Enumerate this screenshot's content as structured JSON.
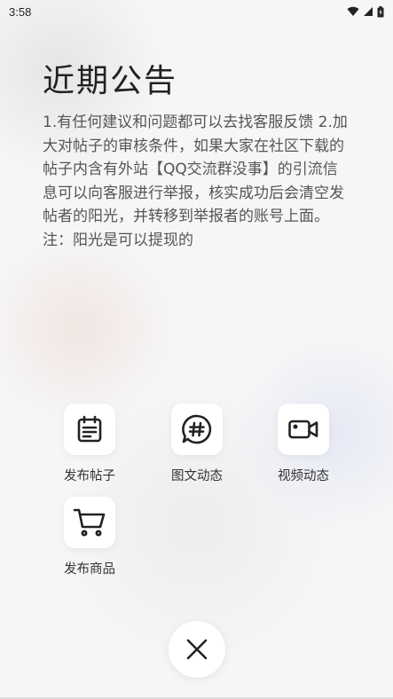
{
  "status_bar": {
    "time": "3:58"
  },
  "notice": {
    "title": "近期公告",
    "body": "1.有任何建议和问题都可以去找客服反馈 2.加大对帖子的审核条件，如果大家在社区下载的帖子内含有外站【QQ交流群没事】的引流信息可以向客服进行举报，核实成功后会清空发帖者的阳光，并转移到举报者的账号上面。注：阳光是可以提现的"
  },
  "actions": [
    {
      "label": "发布帖子",
      "icon": "document-icon"
    },
    {
      "label": "图文动态",
      "icon": "hashtag-bubble-icon"
    },
    {
      "label": "视频动态",
      "icon": "video-camera-icon"
    },
    {
      "label": "发布商品",
      "icon": "shopping-cart-icon"
    }
  ],
  "close": {
    "icon": "close-icon"
  },
  "colors": {
    "background": "#f6f6f7",
    "icon_stroke": "#222222",
    "card": "#ffffff"
  }
}
